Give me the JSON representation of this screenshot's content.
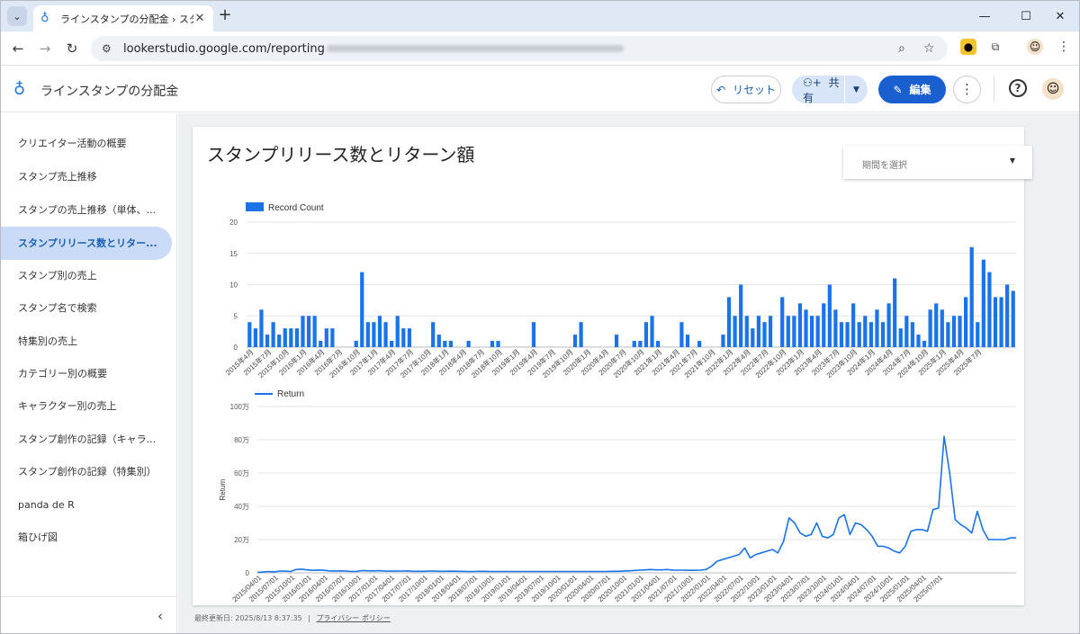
{
  "browser": {
    "tab_title": "ラインスタンプの分配金 › スタンプリ",
    "url": "lookerstudio.google.com/reporting"
  },
  "app": {
    "title": "ラインスタンプの分配金",
    "reset_label": "リセット",
    "share_label": "共有",
    "edit_label": "編集"
  },
  "sidebar": {
    "items": [
      {
        "label": "クリエイター活動の概要"
      },
      {
        "label": "スタンプ売上推移"
      },
      {
        "label": "スタンプの売上推移（単体、..."
      },
      {
        "label": "スタンプリリース数とリター..."
      },
      {
        "label": "スタンプ別の売上"
      },
      {
        "label": "スタンプ名で検索"
      },
      {
        "label": "特集別の売上"
      },
      {
        "label": "カテゴリー別の概要"
      },
      {
        "label": "キャラクター別の売上"
      },
      {
        "label": "スタンプ創作の記録（キャラ..."
      },
      {
        "label": "スタンプ創作の記録（特集別）"
      },
      {
        "label": "panda de R"
      },
      {
        "label": "箱ひげ図"
      }
    ]
  },
  "report": {
    "title": "スタンプリリース数とリターン額",
    "date_picker_placeholder": "期間を選択",
    "footer_updated": "最終更新日: 2025/8/13 8:37:35",
    "footer_privacy": "プライバシー ポリシー"
  },
  "colors": {
    "bar": "#1a73e8",
    "line": "#1a73e8",
    "accent": "#1a5fd0"
  },
  "chart_data": [
    {
      "type": "bar",
      "legend": "Record Count",
      "ylim": [
        0,
        20
      ],
      "yticks": [
        0,
        5,
        10,
        15,
        20
      ],
      "xticklabels": [
        "2015年4月",
        "2015年7月",
        "2015年10月",
        "2016年1月",
        "2016年4月",
        "2016年7月",
        "2016年10月",
        "2017年1月",
        "2017年4月",
        "2017年7月",
        "2017年10月",
        "2018年1月",
        "2018年4月",
        "2018年7月",
        "2018年10月",
        "2019年1月",
        "2019年4月",
        "2019年7月",
        "2019年10月",
        "2020年1月",
        "2020年4月",
        "2020年7月",
        "2020年10月",
        "2021年1月",
        "2021年4月",
        "2021年7月",
        "2021年10月",
        "2022年1月",
        "2022年4月",
        "2022年7月",
        "2022年10月",
        "2023年1月",
        "2023年4月",
        "2023年7月",
        "2023年10月",
        "2024年1月",
        "2024年4月",
        "2024年7月",
        "2024年10月",
        "2025年1月",
        "2025年4月",
        "2025年7月"
      ],
      "values": [
        4,
        3,
        6,
        2,
        4,
        2,
        3,
        3,
        3,
        5,
        5,
        5,
        1,
        3,
        3,
        0,
        0,
        0,
        1,
        12,
        4,
        4,
        5,
        4,
        1,
        5,
        3,
        3,
        0,
        0,
        0,
        4,
        2,
        1,
        1,
        0,
        0,
        1,
        0,
        0,
        0,
        1,
        1,
        0,
        0,
        0,
        0,
        0,
        4,
        0,
        0,
        0,
        0,
        0,
        0,
        2,
        4,
        0,
        0,
        0,
        0,
        0,
        2,
        0,
        0,
        1,
        1,
        4,
        5,
        1,
        0,
        0,
        0,
        4,
        2,
        0,
        1,
        0,
        0,
        0,
        2,
        8,
        5,
        10,
        5,
        3,
        5,
        4,
        5,
        0,
        8,
        5,
        5,
        7,
        6,
        5,
        5,
        7,
        10,
        6,
        4,
        4,
        7,
        4,
        5,
        4,
        6,
        4,
        7,
        11,
        3,
        5,
        4,
        2,
        1,
        6,
        7,
        6,
        4,
        5,
        5,
        8,
        16,
        4,
        14,
        12,
        8,
        8,
        10,
        9
      ]
    },
    {
      "type": "line",
      "legend": "Return",
      "ylabel": "Return",
      "ylim": [
        0,
        1000000
      ],
      "yticks": [
        "0",
        "20万",
        "40万",
        "60万",
        "80万",
        "100万"
      ],
      "xticklabels": [
        "2015/04/01",
        "2015/07/01",
        "2015/10/01",
        "2016/01/01",
        "2016/04/01",
        "2016/07/01",
        "2016/10/01",
        "2017/01/01",
        "2017/04/01",
        "2017/07/01",
        "2017/10/01",
        "2018/01/01",
        "2018/04/01",
        "2018/07/01",
        "2018/10/01",
        "2019/01/01",
        "2019/04/01",
        "2019/07/01",
        "2019/10/01",
        "2020/01/01",
        "2020/04/01",
        "2020/07/01",
        "2020/10/01",
        "2021/01/01",
        "2021/04/01",
        "2021/07/01",
        "2021/10/01",
        "2022/01/01",
        "2022/04/01",
        "2022/07/01",
        "2022/10/01",
        "2023/01/01",
        "2023/04/01",
        "2023/07/01",
        "2023/10/01",
        "2024/01/01",
        "2024/04/01",
        "2024/07/01",
        "2024/10/01",
        "2025/01/01",
        "2025/04/01",
        "2025/07/01"
      ],
      "values": [
        2000,
        5000,
        8000,
        6000,
        10000,
        10000,
        8000,
        20000,
        22000,
        18000,
        15000,
        17000,
        15000,
        12000,
        10000,
        12000,
        10000,
        8000,
        9000,
        14000,
        12000,
        12000,
        13000,
        10000,
        10000,
        10000,
        11000,
        12000,
        9000,
        9000,
        9000,
        10000,
        11000,
        9000,
        9000,
        10000,
        9000,
        9000,
        8000,
        8000,
        9000,
        9000,
        8000,
        8000,
        8000,
        8000,
        8000,
        8000,
        8000,
        8000,
        8000,
        8000,
        8000,
        8000,
        8000,
        8000,
        8000,
        8000,
        8000,
        8000,
        8000,
        8000,
        8000,
        8000,
        9000,
        9000,
        10000,
        12000,
        14000,
        16000,
        18000,
        20000,
        18000,
        18000,
        20000,
        17000,
        16000,
        16000,
        15000,
        15000,
        16000,
        20000,
        40000,
        70000,
        80000,
        90000,
        100000,
        110000,
        150000,
        90000,
        110000,
        120000,
        130000,
        140000,
        120000,
        190000,
        330000,
        300000,
        240000,
        220000,
        230000,
        300000,
        220000,
        210000,
        230000,
        330000,
        350000,
        230000,
        300000,
        290000,
        260000,
        220000,
        160000,
        160000,
        150000,
        130000,
        120000,
        160000,
        250000,
        260000,
        260000,
        250000,
        380000,
        390000,
        820000,
        600000,
        320000,
        290000,
        270000,
        240000,
        370000,
        260000,
        200000,
        200000,
        200000,
        200000,
        210000,
        210000
      ]
    }
  ]
}
